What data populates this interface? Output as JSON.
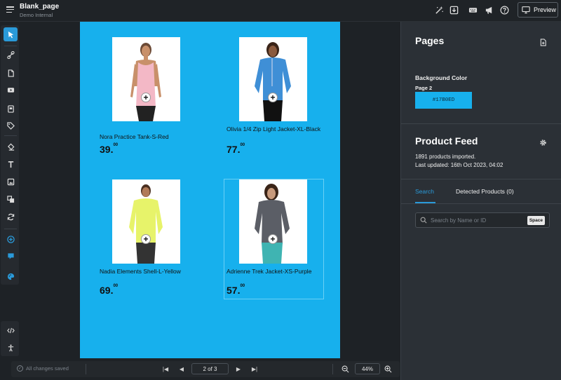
{
  "header": {
    "title": "Blank_page",
    "subtitle": "Demo Internal",
    "preview_label": "Preview"
  },
  "canvas": {
    "background": "#17B0ED",
    "products": [
      {
        "name": "Nora Practice Tank-S-Red",
        "price_main": "39.",
        "price_cents": "00",
        "shirt_color": "#f3b8c6"
      },
      {
        "name": "Olivia 1/4 Zip Light Jacket-XL-Black",
        "price_main": "77.",
        "price_cents": "00",
        "shirt_color": "#3f8fd6"
      },
      {
        "name": "Nadia Elements Shell-L-Yellow",
        "price_main": "69.",
        "price_cents": "00",
        "shirt_color": "#e7f36a"
      },
      {
        "name": "Adrienne Trek Jacket-XS-Purple",
        "price_main": "57.",
        "price_cents": "00",
        "shirt_color": "#5b5e66"
      }
    ]
  },
  "status": {
    "saved_text": "All changes saved",
    "page_indicator": "2 of 3",
    "zoom": "44%"
  },
  "panel": {
    "pages_title": "Pages",
    "bg_color_label": "Background Color",
    "page_label": "Page 2",
    "bg_color_value": "#17B0ED",
    "feed_title": "Product Feed",
    "imported_text": "1891 products imported.",
    "updated_text": "Last updated: 16th Oct 2023, 04:02",
    "tab_search": "Search",
    "tab_detected": "Detected Products (0)",
    "search_placeholder": "Search by Name or ID",
    "space_key": "Space"
  },
  "colors": {
    "accent": "#2A9AD9",
    "panel_bg": "#2B3036"
  }
}
